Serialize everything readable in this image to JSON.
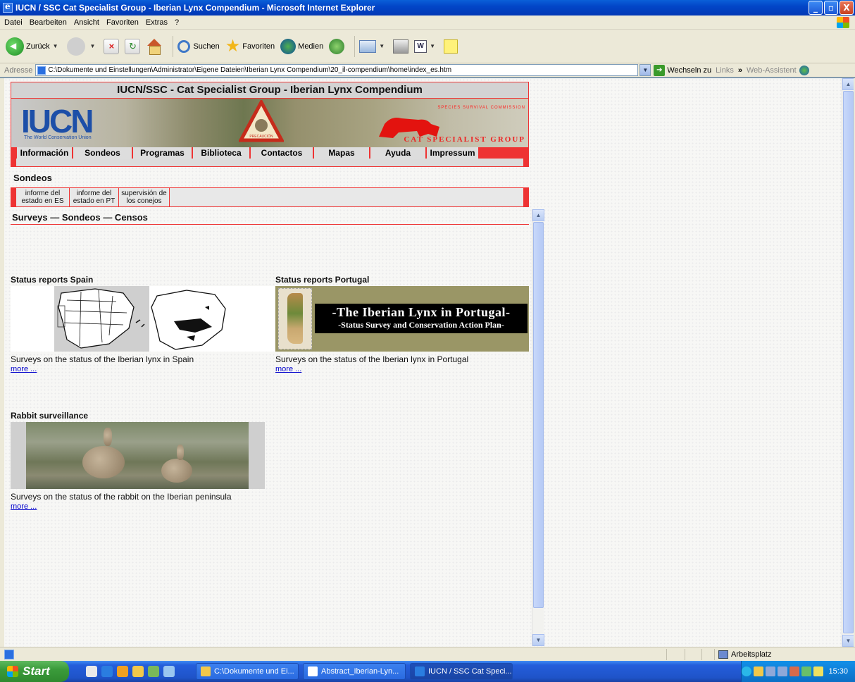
{
  "window": {
    "title": "IUCN / SSC Cat Specialist Group - Iberian Lynx Compendium - Microsoft Internet Explorer",
    "controls": [
      "_",
      "▫",
      "X"
    ]
  },
  "menubar": [
    "Datei",
    "Bearbeiten",
    "Ansicht",
    "Favoriten",
    "Extras",
    "?"
  ],
  "toolbar": {
    "back_label": "Zurück",
    "search_label": "Suchen",
    "favorites_label": "Favoriten",
    "media_label": "Medien"
  },
  "addressbar": {
    "label": "Adresse",
    "url": "C:\\Dokumente und Einstellungen\\Administrator\\Eigene Dateien\\Iberian Lynx Compendium\\20_il-compendium\\home\\index_es.htm",
    "go_label": "Wechseln zu",
    "links_label": "Links",
    "assistant_label": "Web-Assistent"
  },
  "site": {
    "header": "IUCN/SSC - Cat Specialist Group - Iberian Lynx Compendium",
    "logo_text": "IUCN",
    "logo_sub": "The World Conservation Union",
    "warning_text": "PRECAUCIÓN",
    "csg_top": "SPECIES SURVIVAL COMMISSION",
    "csg_name": "CAT SPECIALIST GROUP",
    "nav": [
      "Información",
      "Sondeos",
      "Programas",
      "Biblioteca",
      "Contactos",
      "Mapas",
      "Ayuda",
      "Impressum"
    ],
    "section_title": "Sondeos",
    "subnav": [
      "informe del estado en ES",
      "informe del estado en PT",
      "supervisión de los conejos"
    ]
  },
  "frame": {
    "heading": "Surveys — Sondeos — Censos",
    "reports": [
      {
        "title": "Status reports Spain",
        "desc": "Surveys on the status of the Iberian lynx in Spain",
        "link": "more ..."
      },
      {
        "title": "Status reports Portugal",
        "desc": "Surveys on the status of the Iberian lynx in Portugal",
        "link": "more ...",
        "banner_l1": "-The Iberian Lynx in Portugal-",
        "banner_l2": "-Status Survey and Conservation Action Plan-"
      },
      {
        "title": "Rabbit surveillance",
        "desc": "Surveys on the status of the rabbit on the Iberian peninsula",
        "link": "more ..."
      }
    ]
  },
  "statusbar": {
    "zone": "Arbeitsplatz"
  },
  "taskbar": {
    "start": "Start",
    "tasks": [
      "C:\\Dokumente und Ei...",
      "Abstract_Iberian-Lyn...",
      "IUCN / SSC Cat Speci..."
    ],
    "clock": "15:30"
  }
}
